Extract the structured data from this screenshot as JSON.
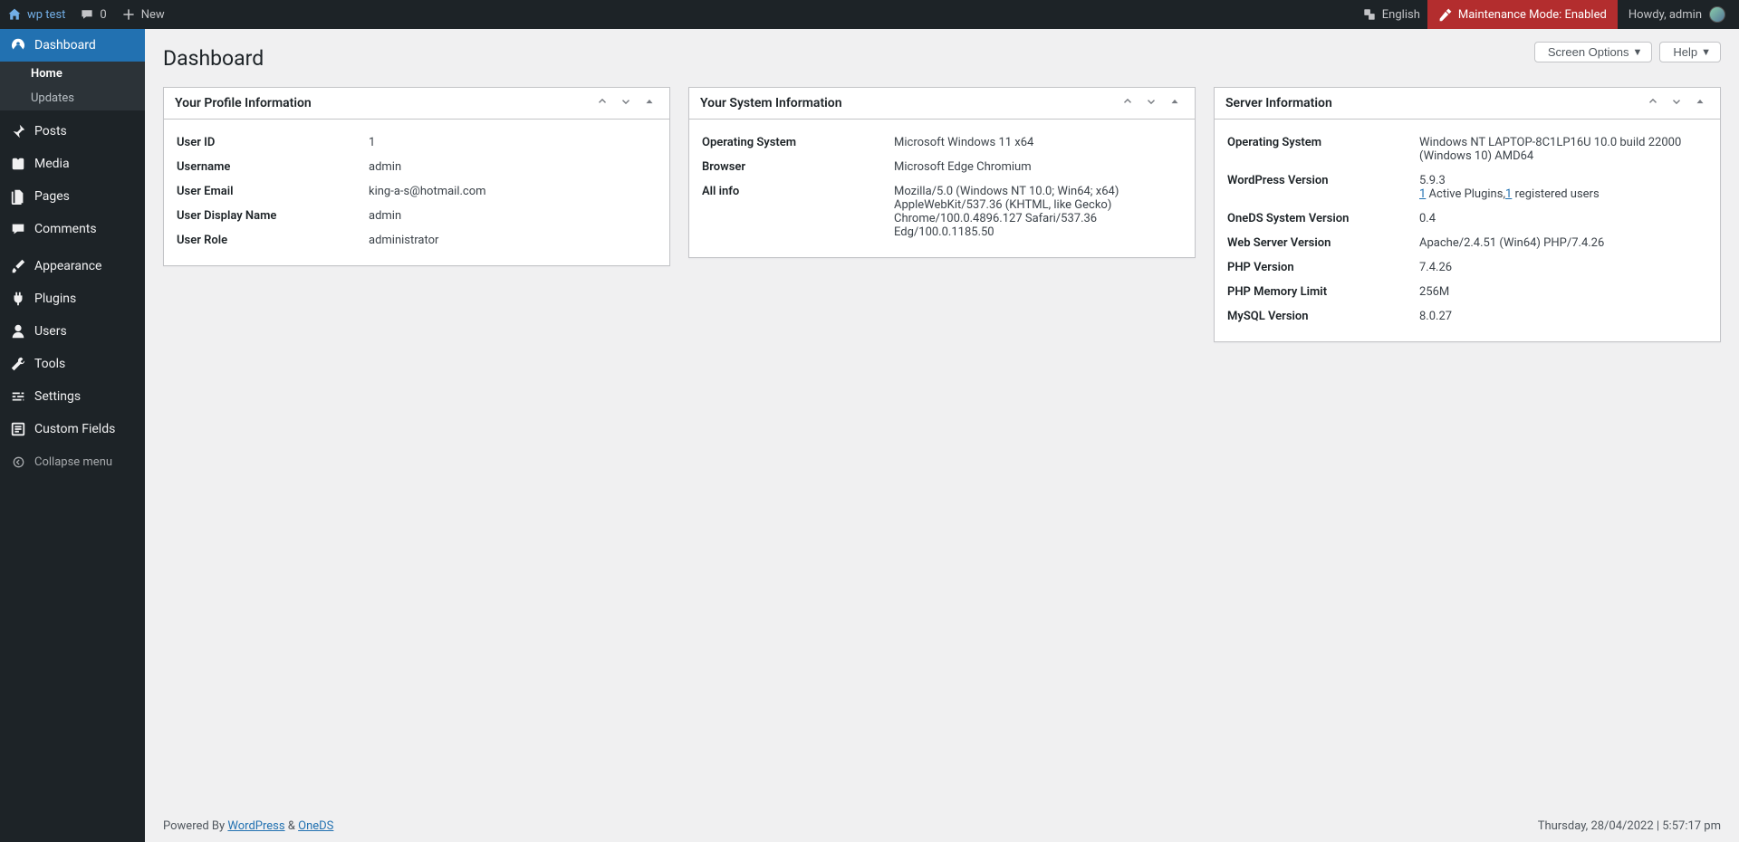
{
  "adminbar": {
    "site_name": "wp test",
    "comments_count": "0",
    "new_label": "New",
    "language_label": "English",
    "maintenance_label": "Maintenance Mode: Enabled",
    "howdy_label": "Howdy, admin"
  },
  "sidebar": {
    "items": [
      {
        "label": "Dashboard",
        "icon": "dashboard-icon",
        "selected": true,
        "submenu": [
          {
            "label": "Home",
            "current": true
          },
          {
            "label": "Updates",
            "current": false
          }
        ]
      },
      {
        "label": "Posts",
        "icon": "pin-icon"
      },
      {
        "label": "Media",
        "icon": "media-icon"
      },
      {
        "label": "Pages",
        "icon": "pages-icon"
      },
      {
        "label": "Comments",
        "icon": "comment-icon"
      },
      {
        "label": "Appearance",
        "icon": "brush-icon"
      },
      {
        "label": "Plugins",
        "icon": "plugin-icon"
      },
      {
        "label": "Users",
        "icon": "user-icon"
      },
      {
        "label": "Tools",
        "icon": "wrench-icon"
      },
      {
        "label": "Settings",
        "icon": "sliders-icon"
      },
      {
        "label": "Custom Fields",
        "icon": "fields-icon"
      }
    ],
    "collapse_label": "Collapse menu"
  },
  "page": {
    "title": "Dashboard",
    "screen_options_label": "Screen Options",
    "help_label": "Help"
  },
  "widgets": {
    "profile": {
      "title": "Your Profile Information",
      "rows": [
        {
          "label": "User ID",
          "value": "1"
        },
        {
          "label": "Username",
          "value": "admin"
        },
        {
          "label": "User Email",
          "value": "king-a-s@hotmail.com"
        },
        {
          "label": "User Display Name",
          "value": "admin"
        },
        {
          "label": "User Role",
          "value": "administrator"
        }
      ]
    },
    "system": {
      "title": "Your System Information",
      "rows": [
        {
          "label": "Operating System",
          "value": "Microsoft Windows 11 x64"
        },
        {
          "label": "Browser",
          "value": "Microsoft Edge Chromium"
        },
        {
          "label": "All info",
          "value": "Mozilla/5.0 (Windows NT 10.0; Win64; x64) AppleWebKit/537.36 (KHTML, like Gecko) Chrome/100.0.4896.127 Safari/537.36 Edg/100.0.1185.50"
        }
      ]
    },
    "server": {
      "title": "Server Information",
      "rows": [
        {
          "label": "Operating System",
          "value": "Windows NT LAPTOP-8C1LP16U 10.0 build 22000 (Windows 10) AMD64"
        },
        {
          "label": "WordPress Version",
          "value": "5.9.3",
          "extra_html": true,
          "active_plugins_link": "1",
          "active_plugins_text": " Active Plugins,",
          "registered_users_link": "1",
          "registered_users_text": " registered users"
        },
        {
          "label": "OneDS System Version",
          "value": "0.4"
        },
        {
          "label": "Web Server Version",
          "value": "Apache/2.4.51 (Win64) PHP/7.4.26"
        },
        {
          "label": "PHP Version",
          "value": "7.4.26"
        },
        {
          "label": "PHP Memory Limit",
          "value": "256M"
        },
        {
          "label": "MySQL Version",
          "value": "8.0.27"
        }
      ]
    }
  },
  "footer": {
    "powered_by_prefix": "Powered By ",
    "wordpress_link": "WordPress",
    "amp": " & ",
    "oneds_link": "OneDS",
    "datetime": "Thursday, 28/04/2022 | 5:57:17 pm"
  }
}
